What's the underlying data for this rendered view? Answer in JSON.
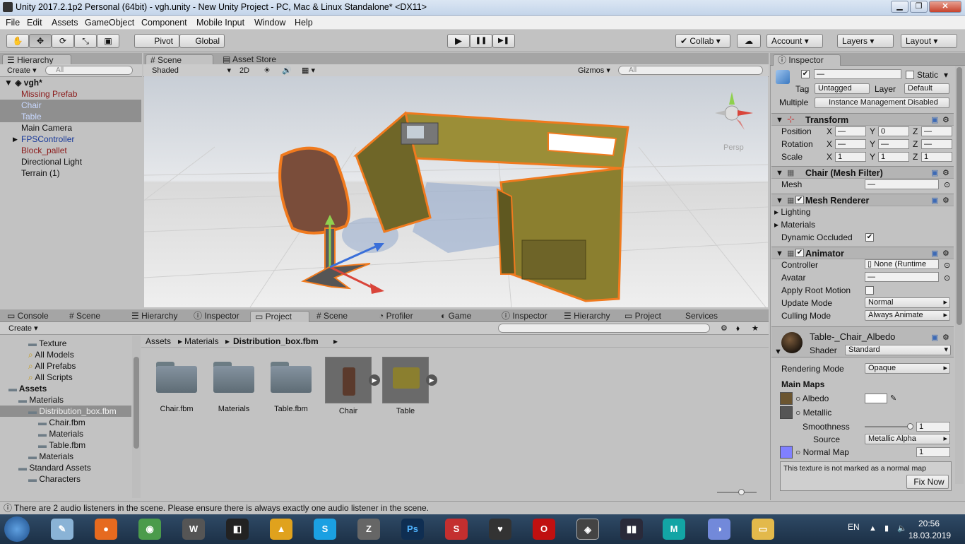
{
  "window": {
    "title": "Unity 2017.2.1p2 Personal (64bit) - vgh.unity - New Unity Project - PC, Mac & Linux Standalone* <DX11>",
    "min": "▁",
    "max": "❐",
    "close": "✕"
  },
  "menu": [
    "File",
    "Edit",
    "Assets",
    "GameObject",
    "Component",
    "Mobile Input",
    "Window",
    "Help"
  ],
  "toolbar": {
    "pivot": "Pivot",
    "global": "Global",
    "collab": "Collab",
    "account": "Account",
    "layers": "Layers",
    "layout": "Layout",
    "play": "▶",
    "pause": "❚❚",
    "step": "▶❚",
    "transform_tools": [
      "✋",
      "✥",
      "⟳",
      "⤡",
      "▣"
    ]
  },
  "hierarchy": {
    "tab": "Hierarchy",
    "create": "Create",
    "search_placeholder": "All",
    "scene_name": "vgh*",
    "items": [
      {
        "label": "Missing Prefab",
        "color": "#8b1a1a",
        "selected": false
      },
      {
        "label": "Chair",
        "color": "#c8d8ff",
        "selected": true
      },
      {
        "label": "Table",
        "color": "#c8d8ff",
        "selected": true
      },
      {
        "label": "Main Camera",
        "color": "#111111",
        "selected": false
      },
      {
        "label": "FPSController",
        "color": "#1a3a9a",
        "selected": false
      },
      {
        "label": "Block_pallet",
        "color": "#8b1a1a",
        "selected": false
      },
      {
        "label": "Directional Light",
        "color": "#111111",
        "selected": false
      },
      {
        "label": "Terrain (1)",
        "color": "#111111",
        "selected": false
      }
    ]
  },
  "scene_view": {
    "tabs": [
      "Scene",
      "Asset Store"
    ],
    "shading": "Shaded",
    "mode_2d": "2D",
    "gizmos": "Gizmos",
    "search_placeholder": "All",
    "persp": "Persp"
  },
  "bottom_tabs": [
    "Console",
    "Scene",
    "Hierarchy",
    "Inspector",
    "Project",
    "Scene",
    "Profiler",
    "Game",
    "Inspector",
    "Hierarchy",
    "Project",
    "Services"
  ],
  "project": {
    "create": "Create",
    "breadcrumb": [
      "Assets",
      "Materials",
      "Distribution_box.fbm"
    ],
    "tree": [
      {
        "label": "Texture",
        "indent": 2,
        "icon": "folder"
      },
      {
        "label": "All Models",
        "indent": 2,
        "icon": "search"
      },
      {
        "label": "All Prefabs",
        "indent": 2,
        "icon": "search"
      },
      {
        "label": "All Scripts",
        "indent": 2,
        "icon": "search"
      },
      {
        "label": "Assets",
        "indent": 0,
        "icon": "folder",
        "bold": true
      },
      {
        "label": "Materials",
        "indent": 1,
        "icon": "folder"
      },
      {
        "label": "Distribution_box.fbm",
        "indent": 2,
        "icon": "folder",
        "selected": true
      },
      {
        "label": "Chair.fbm",
        "indent": 3,
        "icon": "folder"
      },
      {
        "label": "Materials",
        "indent": 3,
        "icon": "folder"
      },
      {
        "label": "Table.fbm",
        "indent": 3,
        "icon": "folder"
      },
      {
        "label": "Materials",
        "indent": 2,
        "icon": "folder"
      },
      {
        "label": "Standard Assets",
        "indent": 1,
        "icon": "folder"
      },
      {
        "label": "Characters",
        "indent": 2,
        "icon": "folder"
      }
    ],
    "assets": [
      {
        "label": "Chair.fbm",
        "kind": "folder"
      },
      {
        "label": "Materials",
        "kind": "folder"
      },
      {
        "label": "Table.fbm",
        "kind": "folder"
      },
      {
        "label": "Chair",
        "kind": "model"
      },
      {
        "label": "Table",
        "kind": "model"
      }
    ]
  },
  "inspector": {
    "tab": "Inspector",
    "name_value": "—",
    "static": "Static",
    "tag_label": "Tag",
    "tag": "Untagged",
    "layer_label": "Layer",
    "layer": "Default",
    "multiple": "Multiple",
    "instance_mgmt": "Instance Management Disabled",
    "transform": {
      "title": "Transform",
      "rows": [
        {
          "label": "Position",
          "x": "—",
          "y": "0",
          "z": "—"
        },
        {
          "label": "Rotation",
          "x": "—",
          "y": "—",
          "z": "—"
        },
        {
          "label": "Scale",
          "x": "1",
          "y": "1",
          "z": "1"
        }
      ],
      "axes": [
        "X",
        "Y",
        "Z"
      ]
    },
    "mesh_filter": {
      "title": "Chair (Mesh Filter)",
      "mesh_label": "Mesh",
      "mesh": "—"
    },
    "mesh_renderer": {
      "title": "Mesh Renderer",
      "lighting": "Lighting",
      "materials": "Materials",
      "dynamic": "Dynamic Occluded"
    },
    "animator": {
      "title": "Animator",
      "controller_label": "Controller",
      "controller": "None (Runtime",
      "avatar_label": "Avatar",
      "avatar": "—",
      "apply_root": "Apply Root Motion",
      "update_label": "Update Mode",
      "update": "Normal",
      "culling_label": "Culling Mode",
      "culling": "Always Animate"
    },
    "material": {
      "name": "Table-_Chair_Albedo",
      "shader_label": "Shader",
      "shader": "Standard",
      "rendering_label": "Rendering Mode",
      "rendering": "Opaque",
      "main_maps": "Main Maps",
      "albedo": "Albedo",
      "metallic": "Metallic",
      "smoothness": "Smoothness",
      "smoothness_value": "1",
      "source_label": "Source",
      "source": "Metallic Alpha",
      "normal": "Normal Map",
      "normal_value": "1",
      "warning": "This texture is not marked as a normal map",
      "fix": "Fix Now"
    }
  },
  "status": {
    "message": "There are 2 audio listeners in the scene. Please ensure there is always exactly one audio listener in the scene."
  },
  "taskbar": {
    "lang": "EN",
    "time": "20:56",
    "date": "18.03.2019"
  },
  "colors": {
    "selection": "#8f8f8f",
    "accent_blue": "#3d6ab5",
    "outline": "#f07a1e"
  }
}
